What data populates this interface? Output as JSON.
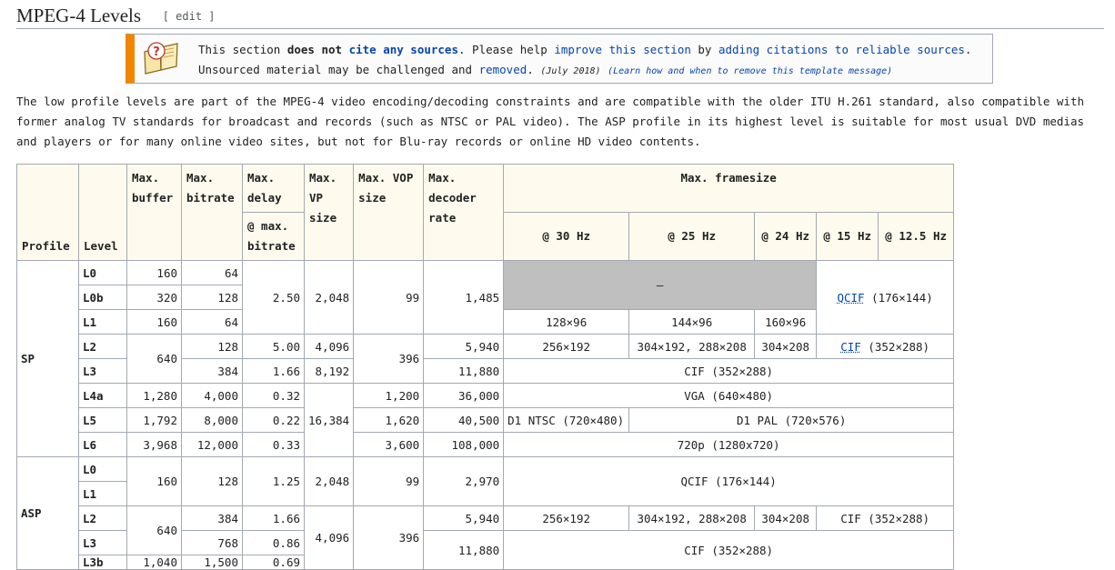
{
  "heading": {
    "title": "MPEG-4 Levels",
    "edit_label": "[ edit ]"
  },
  "notice": {
    "icon": "book-question-icon",
    "t1": "This section ",
    "t2": "does not ",
    "t3": "cite any sources",
    "t4": ". Please help ",
    "t5": "improve this section",
    "t6": " by ",
    "t7": "adding citations to reliable sources",
    "t8": ".",
    "t9": "Unsourced material may be challenged and ",
    "t10": "removed",
    "t11": ".",
    "date": "(July 2018)",
    "learn": "(Learn how and when to remove this template message)"
  },
  "paragraph": "The low profile levels are part of the MPEG-4 video encoding/decoding constraints and are compatible with the older ITU H.261 standard, also compatible with former analog TV standards for broadcast and records (such as NTSC or PAL video). The ASP profile in its highest level is suitable for most usual DVD medias and players or for many online video sites, but not for Blu-ray records or online HD video contents.",
  "table": {
    "headers": {
      "profile": "Profile",
      "level": "Level",
      "buffer": "Max. buffer",
      "bitrate": "Max. bitrate",
      "delay": "Max. delay",
      "delay_sub": "@ max. bitrate",
      "vp": "Max. VP size",
      "vop": "Max. VOP size",
      "decoder": "Max. decoder rate",
      "framesize": "Max. framesize",
      "hz30": "@ 30 Hz",
      "hz25": "@ 25 Hz",
      "hz24": "@ 24 Hz",
      "hz15": "@ 15 Hz",
      "hz125": "@ 12.5 Hz"
    },
    "sp": {
      "profile": "SP",
      "levels": [
        "L0",
        "L0b",
        "L1",
        "L2",
        "L3",
        "L4a",
        "L5",
        "L6"
      ],
      "buffer": [
        "160",
        "320",
        "160",
        "640",
        "1,280",
        "1,792",
        "3,968"
      ],
      "bitrate": [
        "64",
        "128",
        "64",
        "128",
        "384",
        "4,000",
        "8,000",
        "12,000"
      ],
      "delay": [
        "2.50",
        "5.00",
        "1.66",
        "0.32",
        "0.22",
        "0.33"
      ],
      "vp": [
        "2,048",
        "4,096",
        "8,192",
        "16,384"
      ],
      "vop": [
        "99",
        "396",
        "1,200",
        "1,620",
        "3,600"
      ],
      "decoder": [
        "1,485",
        "5,940",
        "11,880",
        "36,000",
        "40,500",
        "108,000"
      ],
      "dash": "—",
      "qcif_link": "QCIF",
      "qcif_dim": " (176×144)",
      "l1_30": "128×96",
      "l1_25": "144×96",
      "l1_24": "160×96",
      "l2_30": "256×192",
      "l2_25": "304×192, 288×208",
      "l2_24": "304×208",
      "cif_link": "CIF",
      "cif_dim": " (352×288)",
      "l3": "CIF (352×288)",
      "l4a": "VGA (640×480)",
      "l5_30": "D1 NTSC (720×480)",
      "l5_25": "D1 PAL (720×576)",
      "l6": "720p (1280x720)"
    },
    "asp": {
      "profile": "ASP",
      "levels": [
        "L0",
        "L1",
        "L2",
        "L3",
        "L3b"
      ],
      "buffer": [
        "160",
        "640",
        "1,040"
      ],
      "bitrate": [
        "128",
        "384",
        "768",
        "1,500"
      ],
      "delay": [
        "1.25",
        "1.66",
        "0.86",
        "0.69"
      ],
      "vp": [
        "2,048",
        "4,096"
      ],
      "vop": [
        "99",
        "396"
      ],
      "decoder": [
        "2,970",
        "5,940",
        "11,880"
      ],
      "l01": "QCIF (176×144)",
      "l2_30": "256×192",
      "l2_25": "304×192, 288×208",
      "l2_24": "304×208",
      "l2_15": "CIF (352×288)",
      "l3": "CIF (352×288)"
    }
  }
}
